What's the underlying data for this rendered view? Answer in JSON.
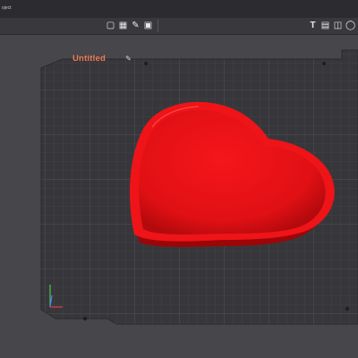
{
  "menubar": {
    "label": "oject"
  },
  "toolbar": {
    "icons": [
      "cube-view-icon",
      "grid-layout-icon",
      "paint-icon",
      "image-icon",
      "text-tool-icon",
      "layers-icon",
      "split-icon",
      "crop-icon",
      "measure-icon",
      "support-icon"
    ]
  },
  "plate": {
    "title": "Untitled",
    "edit_icon": "edit-icon"
  },
  "colors": {
    "model": "#e8141a",
    "plate": "#38383c",
    "title": "#f07a52",
    "background": "#46464b"
  }
}
